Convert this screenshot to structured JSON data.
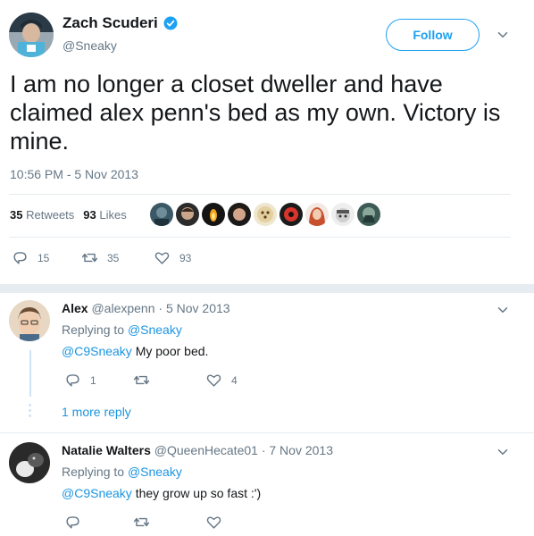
{
  "tweet": {
    "author_name": "Zach Scuderi",
    "author_handle": "@Sneaky",
    "follow_label": "Follow",
    "text": "I am no longer a closet dweller and have claimed alex penn's bed as my own. Victory is mine.",
    "timestamp": "10:56 PM - 5 Nov 2013",
    "retweets_count": "35",
    "retweets_label": "Retweets",
    "likes_count": "93",
    "likes_label": "Likes",
    "reply_count": "15",
    "retweet_count": "35",
    "like_count": "93"
  },
  "replies": [
    {
      "name": "Alex",
      "handle": "@alexpenn",
      "date": "· 5 Nov 2013",
      "replying_prefix": "Replying to",
      "replying_to": "@Sneaky",
      "mention": "@C9Sneaky",
      "text": " My poor bed.",
      "reply_count": "1",
      "retweet_count": "",
      "like_count": "4",
      "more_replies": "1 more reply"
    },
    {
      "name": "Natalie Walters",
      "handle": "@QueenHecate01",
      "date": "· 7 Nov 2013",
      "replying_prefix": "Replying to",
      "replying_to": "@Sneaky",
      "mention": "@C9Sneaky",
      "text": " they grow up so fast :')",
      "reply_count": "",
      "retweet_count": "",
      "like_count": ""
    }
  ],
  "colors": {
    "accent": "#1da1f2",
    "link": "#1b95e0",
    "muted": "#657786",
    "text": "#14171a",
    "divider": "#e6ecf0"
  },
  "icons": {
    "verified": "verified-badge-icon",
    "chevron": "chevron-down-icon",
    "reply": "reply-icon",
    "retweet": "retweet-icon",
    "like": "heart-icon"
  }
}
